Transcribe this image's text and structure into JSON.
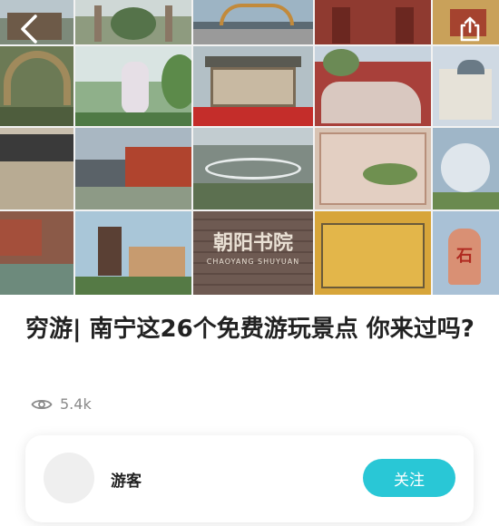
{
  "article": {
    "title": "穷游| 南宁这26个免费游玩景点 你来过吗?",
    "views": "5.4k"
  },
  "author": {
    "name": "游客",
    "follow_label": "关注"
  },
  "collage": {
    "signboard_text": "朝阳书院",
    "signboard_subtext": "CHAOYANG SHUYUAN",
    "stone_text": "石"
  },
  "colors": {
    "accent": "#29c7d6",
    "title": "#222222",
    "muted": "#8a8a8a"
  },
  "icons": {
    "back": "chevron-left-icon",
    "share": "share-icon",
    "views": "eye-icon"
  }
}
